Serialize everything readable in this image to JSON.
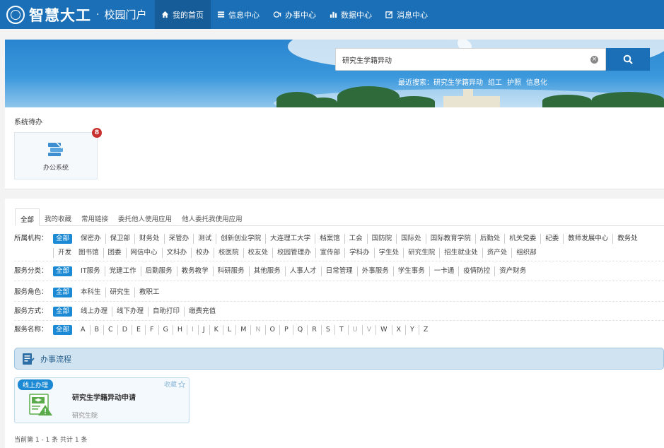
{
  "header": {
    "logo_name": "智慧大工",
    "logo_sep": "·",
    "logo_sub": "校园门户",
    "nav": [
      {
        "label": "我的首页",
        "icon": "home-icon",
        "active": true
      },
      {
        "label": "信息中心",
        "icon": "list-icon",
        "active": false
      },
      {
        "label": "办事中心",
        "icon": "service-icon",
        "active": false
      },
      {
        "label": "数据中心",
        "icon": "bar-chart-icon",
        "active": false
      },
      {
        "label": "消息中心",
        "icon": "edit-message-icon",
        "active": false
      }
    ]
  },
  "search": {
    "value": "研究生学籍异动",
    "clear": "×",
    "recent_label": "最近搜索：",
    "recent": [
      "研究生学籍异动",
      "组工",
      "护照",
      "信息化"
    ]
  },
  "todo": {
    "title": "系统待办",
    "card_label": "办公系统",
    "badge": "8"
  },
  "tabs": [
    "全部",
    "我的收藏",
    "常用链接",
    "委托他人使用应用",
    "他人委托我使用应用"
  ],
  "filters": {
    "org_label": "所属机构：",
    "org": [
      "全部",
      "保密办",
      "保卫部",
      "财务处",
      "采管办",
      "测试",
      "创新创业学院",
      "大连理工大学",
      "档案馆",
      "工会",
      "国防院",
      "国际处",
      "国际教育学院",
      "后勤处",
      "机关党委",
      "纪委",
      "教师发展中心",
      "教务处",
      "开发",
      "图书馆",
      "团委",
      "网信中心",
      "文科办",
      "校办",
      "校医院",
      "校友处",
      "校园管理办",
      "宣传部",
      "学科办",
      "学生处",
      "研究生院",
      "招生就业处",
      "资产处",
      "组织部"
    ],
    "cat_label": "服务分类：",
    "cat": [
      "全部",
      "IT服务",
      "党建工作",
      "后勤服务",
      "教务教学",
      "科研服务",
      "其他服务",
      "人事人才",
      "日常管理",
      "外事服务",
      "学生事务",
      "一卡通",
      "疫情防控",
      "资产财务"
    ],
    "role_label": "服务角色：",
    "role": [
      "全部",
      "本科生",
      "研究生",
      "教职工"
    ],
    "mode_label": "服务方式：",
    "mode": [
      "全部",
      "线上办理",
      "线下办理",
      "自助打印",
      "缴费充值"
    ],
    "name_label": "服务名称：",
    "name": [
      "全部",
      "A",
      "B",
      "C",
      "D",
      "E",
      "F",
      "G",
      "H",
      "I",
      "J",
      "K",
      "L",
      "M",
      "N",
      "O",
      "P",
      "Q",
      "R",
      "S",
      "T",
      "U",
      "V",
      "W",
      "X",
      "Y",
      "Z"
    ],
    "name_dim": [
      "I",
      "N",
      "U",
      "V"
    ]
  },
  "process": {
    "title": "办事流程",
    "card": {
      "tag": "线上办理",
      "fav": "收藏",
      "title": "研究生学籍异动申请",
      "dept": "研究生院"
    }
  },
  "pager": "当前第 1 - 1 条 共计 1 条"
}
